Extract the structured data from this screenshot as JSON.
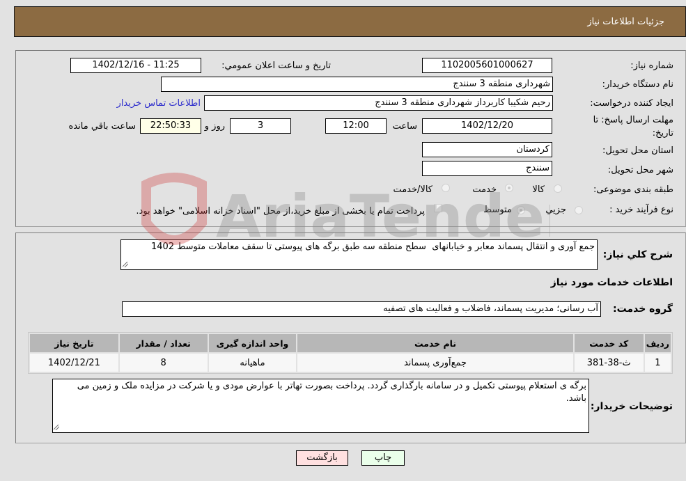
{
  "header": {
    "title": "جزئیات اطلاعات نیاز"
  },
  "details": {
    "need_number_label": "شماره نیاز:",
    "need_number": "1102005601000627",
    "announce_label": "تاریخ و ساعت اعلان عمومي:",
    "announce_value": "1402/12/16 - 11:25",
    "buyer_org_label": "نام دستگاه خريدار:",
    "buyer_org": "شهرداری منطقه 3 سنندج",
    "creator_label": "ايجاد کننده درخواست:",
    "creator": "رحیم شکیبا کاربرداز شهرداری منطقه 3 سنندج",
    "contact_link": "اطلاعات تماس خريدار",
    "deadline_label_1": "مهلت ارسال پاسخ: تا",
    "deadline_label_2": "تاريخ:",
    "deadline_date": "1402/12/20",
    "time_label": "ساعت",
    "deadline_time": "12:00",
    "days_value": "3",
    "days_label": "روز و",
    "remaining_value": "22:50:33",
    "remaining_label": "ساعت باقي مانده",
    "province_label": "استان محل تحويل:",
    "province": "کردستان",
    "city_label": "شهر محل تحويل:",
    "city": "سنندج",
    "category_label": "طبقه بندی موضوعی:",
    "category_options": [
      "کالا",
      "خدمت",
      "کالا/خدمت"
    ],
    "category_selected": "خدمت",
    "process_label": "نوع فرآیند خرید :",
    "process_options": [
      "جزيي",
      "متوسط"
    ],
    "process_selected": "متوسط",
    "treasury_text": "پرداخت تمام يا بخشی از مبلغ خريد،از محل \"اسناد خزانه اسلامی\" خواهد بود."
  },
  "description": {
    "label": "شرح کلي نياز:",
    "value": "جمع آوری و انتقال پسماند معابر و خیابانهای  سطح منطقه سه طبق برگه های پیوستی تا سقف معاملات متوسط 1402"
  },
  "services": {
    "section_title": "اطلاعات خدمات مورد نياز",
    "group_label": "گروه خدمت:",
    "group_value": "آب رسانی؛ مدیریت پسماند، فاضلاب و فعالیت های تصفیه",
    "columns": [
      "رديف",
      "کد خدمت",
      "نام خدمت",
      "واحد اندازه گيری",
      "تعداد / مقدار",
      "تاريخ نياز"
    ],
    "rows": [
      [
        "1",
        "ث-38-381",
        "جمع‌آوری پسماند",
        "ماهیانه",
        "8",
        "1402/12/21"
      ]
    ]
  },
  "buyer_notes": {
    "label": "توضيحات خريدار:",
    "value": "برگه ی استعلام پیوستی تکمیل و در سامانه بارگذاری گردد. پرداخت بصورت تهاتر با عوارض مودی و یا شرکت در مزایده ملک و زمین می باشد."
  },
  "buttons": {
    "print": "چاپ",
    "back": "بازگشت"
  },
  "watermark": {
    "text": "AriaTender.net"
  },
  "colors": {
    "header_bg": "#8c6b42",
    "print_bg": "#eaffea",
    "back_bg": "#ffe0e0",
    "link": "#2b2bcc"
  }
}
